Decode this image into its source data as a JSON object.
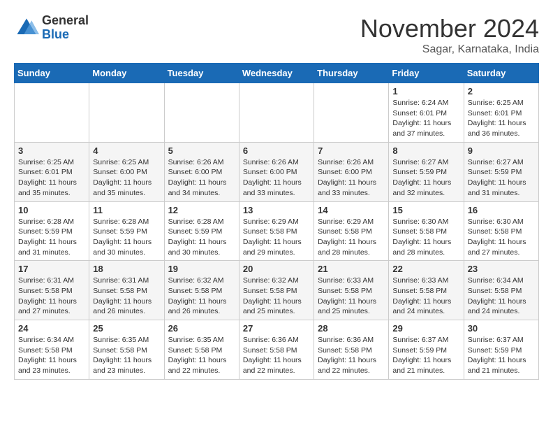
{
  "logo": {
    "general": "General",
    "blue": "Blue"
  },
  "header": {
    "title": "November 2024",
    "subtitle": "Sagar, Karnataka, India"
  },
  "weekdays": [
    "Sunday",
    "Monday",
    "Tuesday",
    "Wednesday",
    "Thursday",
    "Friday",
    "Saturday"
  ],
  "weeks": [
    [
      {
        "day": "",
        "info": ""
      },
      {
        "day": "",
        "info": ""
      },
      {
        "day": "",
        "info": ""
      },
      {
        "day": "",
        "info": ""
      },
      {
        "day": "",
        "info": ""
      },
      {
        "day": "1",
        "info": "Sunrise: 6:24 AM\nSunset: 6:01 PM\nDaylight: 11 hours and 37 minutes."
      },
      {
        "day": "2",
        "info": "Sunrise: 6:25 AM\nSunset: 6:01 PM\nDaylight: 11 hours and 36 minutes."
      }
    ],
    [
      {
        "day": "3",
        "info": "Sunrise: 6:25 AM\nSunset: 6:01 PM\nDaylight: 11 hours and 35 minutes."
      },
      {
        "day": "4",
        "info": "Sunrise: 6:25 AM\nSunset: 6:00 PM\nDaylight: 11 hours and 35 minutes."
      },
      {
        "day": "5",
        "info": "Sunrise: 6:26 AM\nSunset: 6:00 PM\nDaylight: 11 hours and 34 minutes."
      },
      {
        "day": "6",
        "info": "Sunrise: 6:26 AM\nSunset: 6:00 PM\nDaylight: 11 hours and 33 minutes."
      },
      {
        "day": "7",
        "info": "Sunrise: 6:26 AM\nSunset: 6:00 PM\nDaylight: 11 hours and 33 minutes."
      },
      {
        "day": "8",
        "info": "Sunrise: 6:27 AM\nSunset: 5:59 PM\nDaylight: 11 hours and 32 minutes."
      },
      {
        "day": "9",
        "info": "Sunrise: 6:27 AM\nSunset: 5:59 PM\nDaylight: 11 hours and 31 minutes."
      }
    ],
    [
      {
        "day": "10",
        "info": "Sunrise: 6:28 AM\nSunset: 5:59 PM\nDaylight: 11 hours and 31 minutes."
      },
      {
        "day": "11",
        "info": "Sunrise: 6:28 AM\nSunset: 5:59 PM\nDaylight: 11 hours and 30 minutes."
      },
      {
        "day": "12",
        "info": "Sunrise: 6:28 AM\nSunset: 5:59 PM\nDaylight: 11 hours and 30 minutes."
      },
      {
        "day": "13",
        "info": "Sunrise: 6:29 AM\nSunset: 5:58 PM\nDaylight: 11 hours and 29 minutes."
      },
      {
        "day": "14",
        "info": "Sunrise: 6:29 AM\nSunset: 5:58 PM\nDaylight: 11 hours and 28 minutes."
      },
      {
        "day": "15",
        "info": "Sunrise: 6:30 AM\nSunset: 5:58 PM\nDaylight: 11 hours and 28 minutes."
      },
      {
        "day": "16",
        "info": "Sunrise: 6:30 AM\nSunset: 5:58 PM\nDaylight: 11 hours and 27 minutes."
      }
    ],
    [
      {
        "day": "17",
        "info": "Sunrise: 6:31 AM\nSunset: 5:58 PM\nDaylight: 11 hours and 27 minutes."
      },
      {
        "day": "18",
        "info": "Sunrise: 6:31 AM\nSunset: 5:58 PM\nDaylight: 11 hours and 26 minutes."
      },
      {
        "day": "19",
        "info": "Sunrise: 6:32 AM\nSunset: 5:58 PM\nDaylight: 11 hours and 26 minutes."
      },
      {
        "day": "20",
        "info": "Sunrise: 6:32 AM\nSunset: 5:58 PM\nDaylight: 11 hours and 25 minutes."
      },
      {
        "day": "21",
        "info": "Sunrise: 6:33 AM\nSunset: 5:58 PM\nDaylight: 11 hours and 25 minutes."
      },
      {
        "day": "22",
        "info": "Sunrise: 6:33 AM\nSunset: 5:58 PM\nDaylight: 11 hours and 24 minutes."
      },
      {
        "day": "23",
        "info": "Sunrise: 6:34 AM\nSunset: 5:58 PM\nDaylight: 11 hours and 24 minutes."
      }
    ],
    [
      {
        "day": "24",
        "info": "Sunrise: 6:34 AM\nSunset: 5:58 PM\nDaylight: 11 hours and 23 minutes."
      },
      {
        "day": "25",
        "info": "Sunrise: 6:35 AM\nSunset: 5:58 PM\nDaylight: 11 hours and 23 minutes."
      },
      {
        "day": "26",
        "info": "Sunrise: 6:35 AM\nSunset: 5:58 PM\nDaylight: 11 hours and 22 minutes."
      },
      {
        "day": "27",
        "info": "Sunrise: 6:36 AM\nSunset: 5:58 PM\nDaylight: 11 hours and 22 minutes."
      },
      {
        "day": "28",
        "info": "Sunrise: 6:36 AM\nSunset: 5:58 PM\nDaylight: 11 hours and 22 minutes."
      },
      {
        "day": "29",
        "info": "Sunrise: 6:37 AM\nSunset: 5:59 PM\nDaylight: 11 hours and 21 minutes."
      },
      {
        "day": "30",
        "info": "Sunrise: 6:37 AM\nSunset: 5:59 PM\nDaylight: 11 hours and 21 minutes."
      }
    ]
  ]
}
